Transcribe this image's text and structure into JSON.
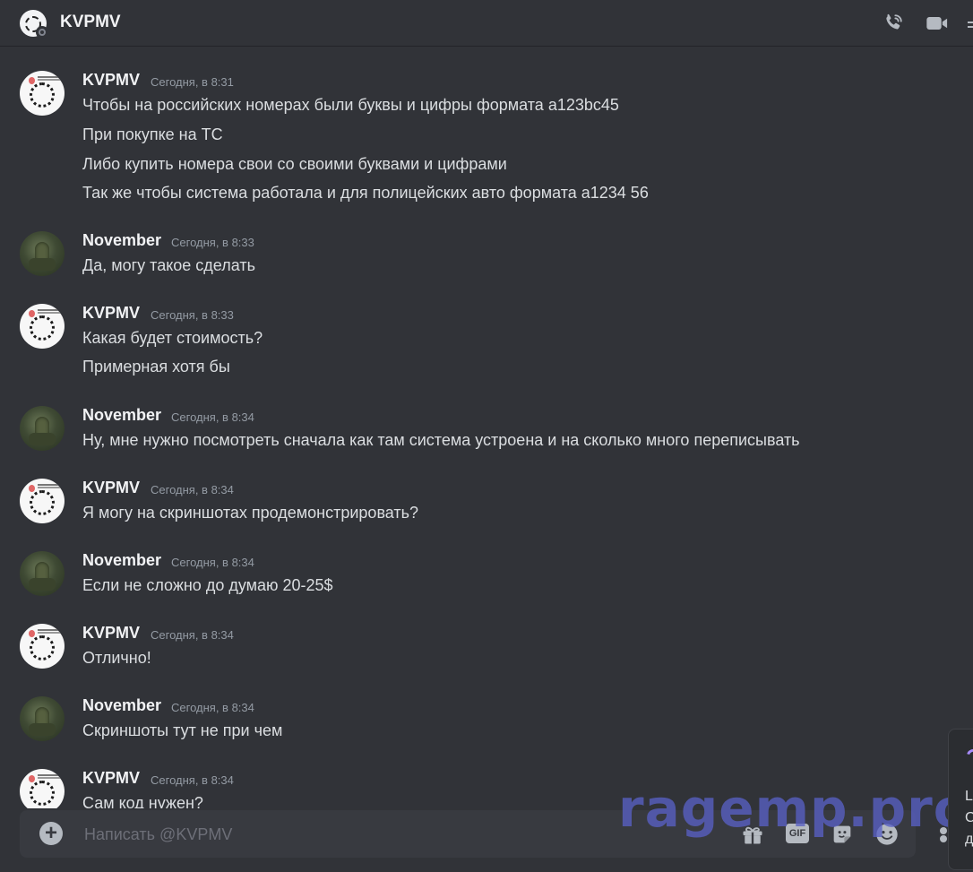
{
  "header": {
    "title": "KVPMV"
  },
  "messages": [
    {
      "author": "KVPMV",
      "avatar": "kvpmv",
      "time": "Сегодня, в 8:31",
      "lines": [
        "Чтобы на российских номерах были буквы и цифры формата а123bc45",
        "При покупке на ТС",
        "Либо купить номера свои со своими буквами и цифрами",
        "Так же чтобы система работала и для полицейских авто формата а1234 56"
      ]
    },
    {
      "author": "November",
      "avatar": "november",
      "time": "Сегодня, в 8:33",
      "lines": [
        "Да, могу такое сделать"
      ]
    },
    {
      "author": "KVPMV",
      "avatar": "kvpmv",
      "time": "Сегодня, в 8:33",
      "lines": [
        "Какая будет стоимость?",
        "Примерная хотя бы"
      ]
    },
    {
      "author": "November",
      "avatar": "november",
      "time": "Сегодня, в 8:34",
      "lines": [
        "Ну, мне нужно посмотреть сначала как там система устроена и на сколько много переписывать"
      ]
    },
    {
      "author": "KVPMV",
      "avatar": "kvpmv",
      "time": "Сегодня, в 8:34",
      "lines": [
        "Я могу на скриншотах продемонстрировать?"
      ]
    },
    {
      "author": "November",
      "avatar": "november",
      "time": "Сегодня, в 8:34",
      "lines": [
        "Если не сложно до думаю 20-25$"
      ]
    },
    {
      "author": "KVPMV",
      "avatar": "kvpmv",
      "time": "Сегодня, в 8:34",
      "lines": [
        "Отлично!"
      ]
    },
    {
      "author": "November",
      "avatar": "november",
      "time": "Сегодня, в 8:34",
      "lines": [
        "Скриншоты тут не при чем"
      ]
    },
    {
      "author": "KVPMV",
      "avatar": "kvpmv",
      "time": "Сегодня, в 8:34",
      "lines": [
        "Сам код нужен?"
      ]
    }
  ],
  "composer": {
    "placeholder": "Написать @KVPMV",
    "gif_label": "GIF"
  },
  "watermark": "ragemp.pro",
  "popup": {
    "lines": [
      "L",
      "C",
      "д"
    ]
  },
  "icons": {
    "header": [
      "phone-call-icon",
      "video-camera-icon"
    ],
    "composer": [
      "plus-icon",
      "gift-icon",
      "gif-icon",
      "sticker-icon",
      "emoji-icon",
      "apps-icon"
    ]
  },
  "colors": {
    "background": "#313338",
    "composer": "#383a40",
    "text": "#dbdee1",
    "muted": "#949ba4",
    "watermark": "#5860c4"
  }
}
